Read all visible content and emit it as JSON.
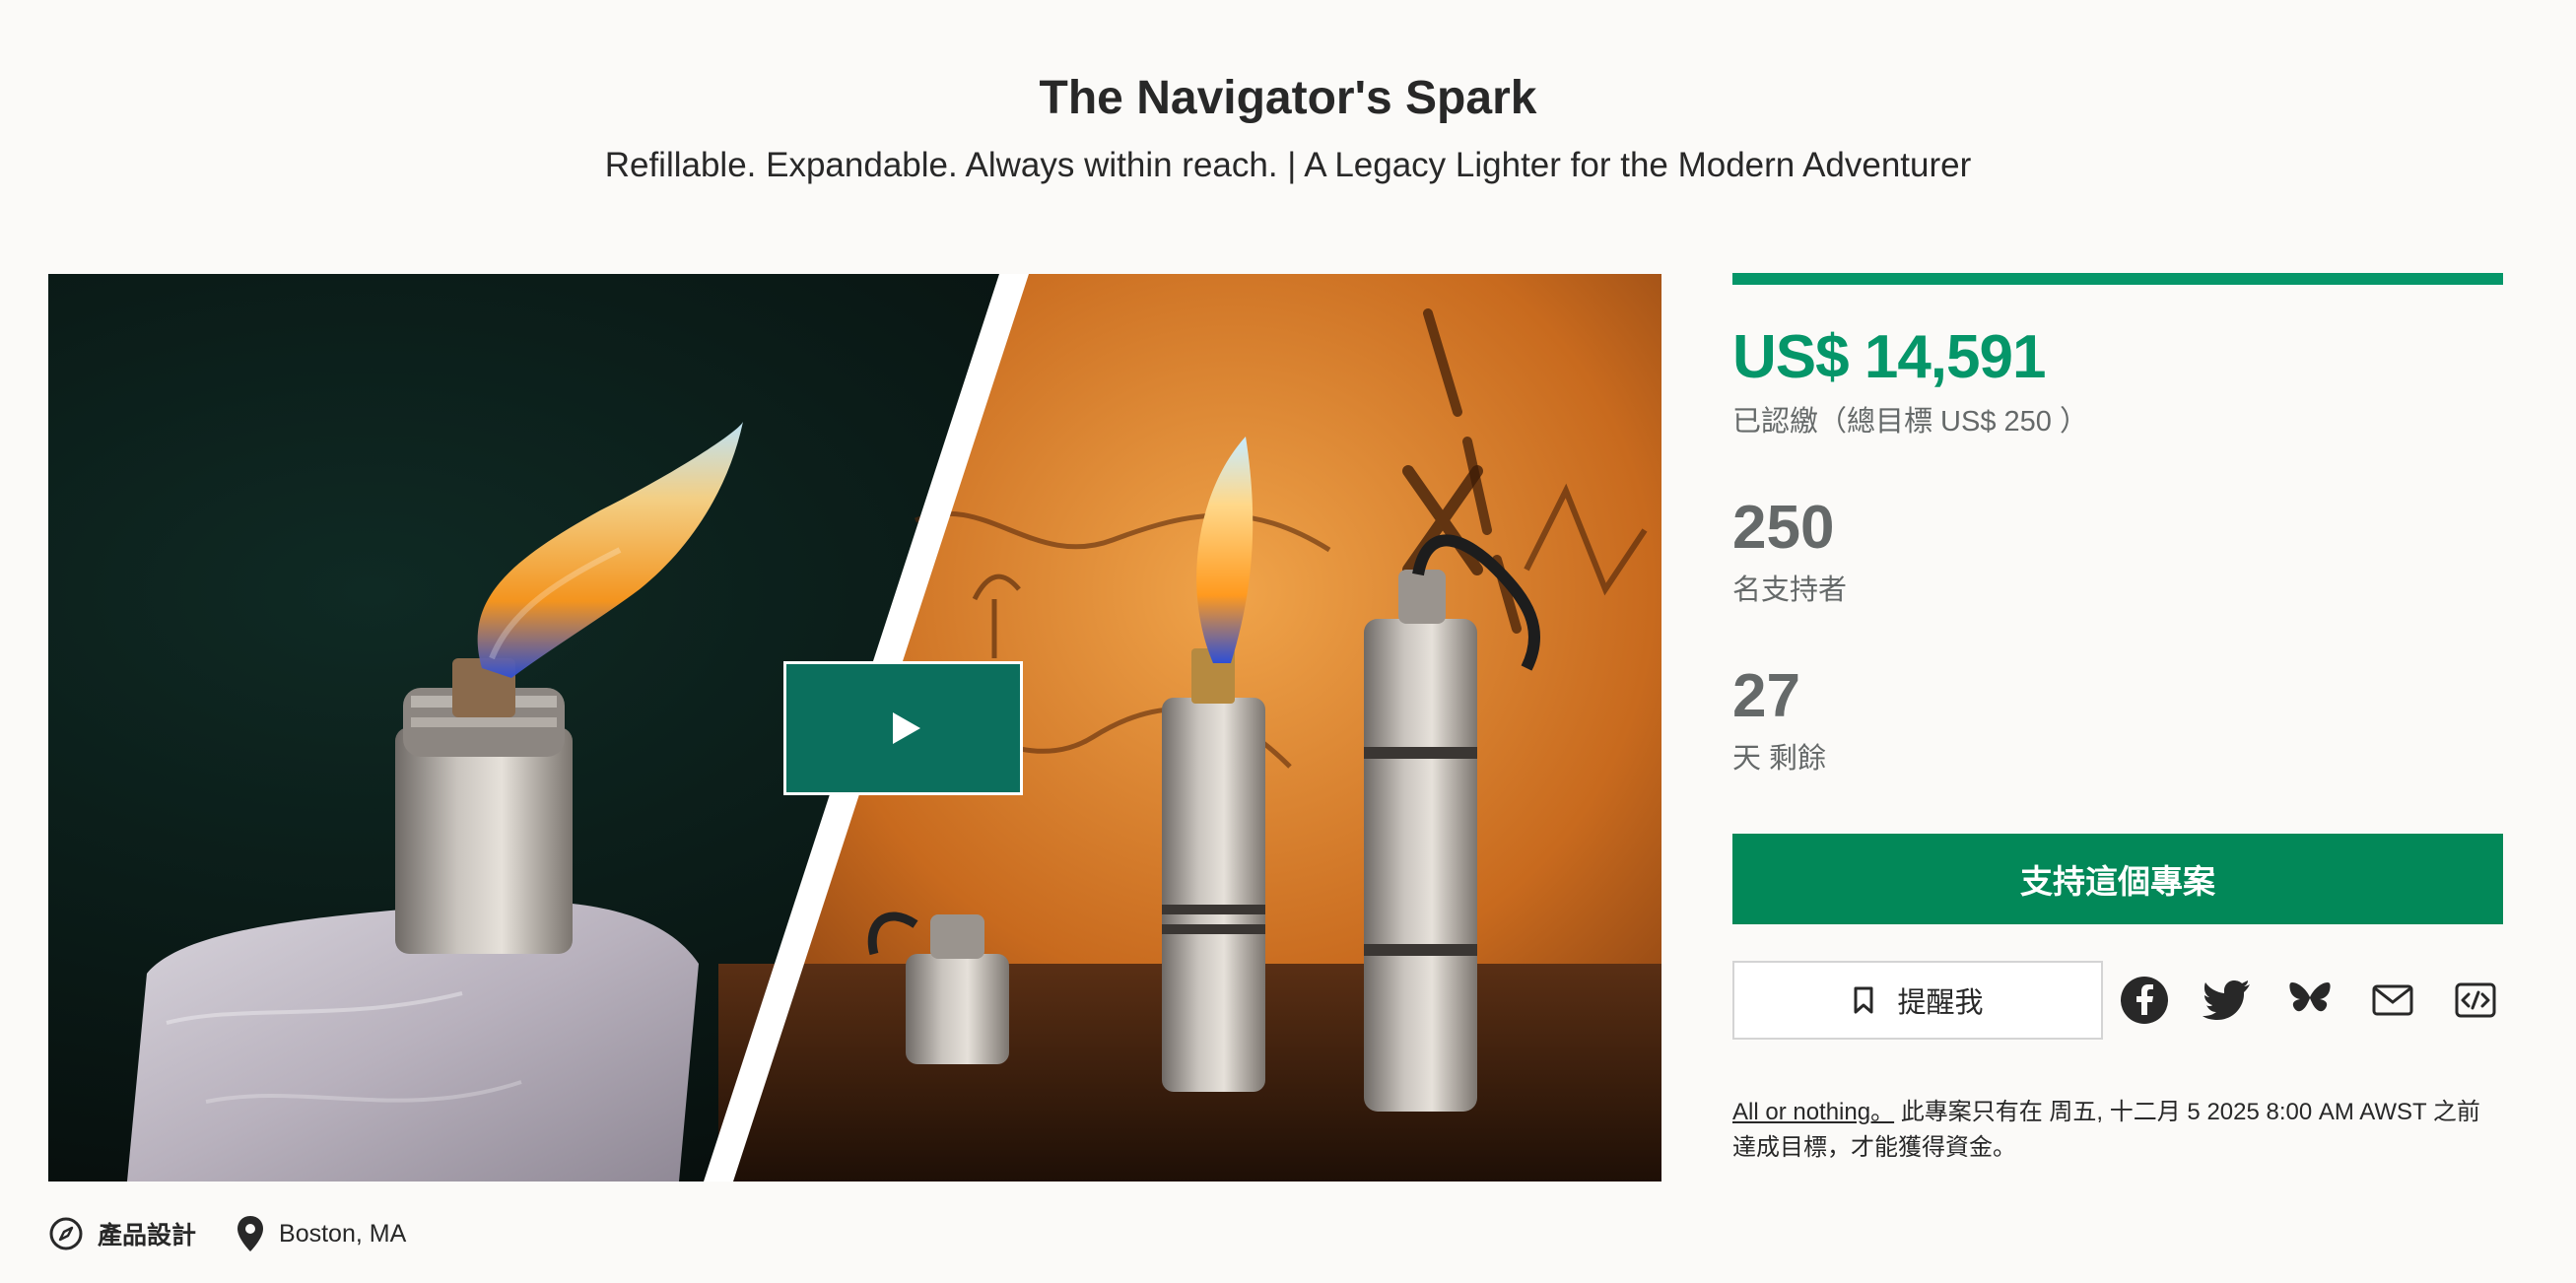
{
  "header": {
    "title": "The Navigator's Spark",
    "subtitle": "Refillable. Expandable. Always within reach. | A Legacy Lighter for the Modern Adventurer"
  },
  "media": {
    "play_icon": "play-icon",
    "left_image": "lighter-flame-on-ice-photo",
    "right_image": "lighters-on-treasure-map-photo"
  },
  "meta": {
    "category": {
      "icon": "compass-icon",
      "label": "產品設計"
    },
    "location": {
      "icon": "map-pin-icon",
      "label": "Boston, MA"
    }
  },
  "campaign": {
    "progress_fraction": 1.0,
    "pledged": "US$ 14,591",
    "pledged_note": "已認繳（總目標 US$ 250 ）",
    "backers_count": "250",
    "backers_label": "名支持者",
    "days_count": "27",
    "days_label": "天 剩餘",
    "back_button": "支持這個專案",
    "remind_button": "提醒我",
    "share": [
      "facebook-icon",
      "twitter-icon",
      "bluesky-icon",
      "mail-icon",
      "embed-icon"
    ],
    "aon_link": "All or nothing。",
    "aon_text": " 此專案只有在 周五, 十二月 5 2025 8:00 AM AWST 之前達成目標，才能獲得資金。"
  },
  "colors": {
    "accent": "#059669",
    "button": "#028858",
    "play_button": "#0b6f5d",
    "muted_text": "#656969"
  }
}
